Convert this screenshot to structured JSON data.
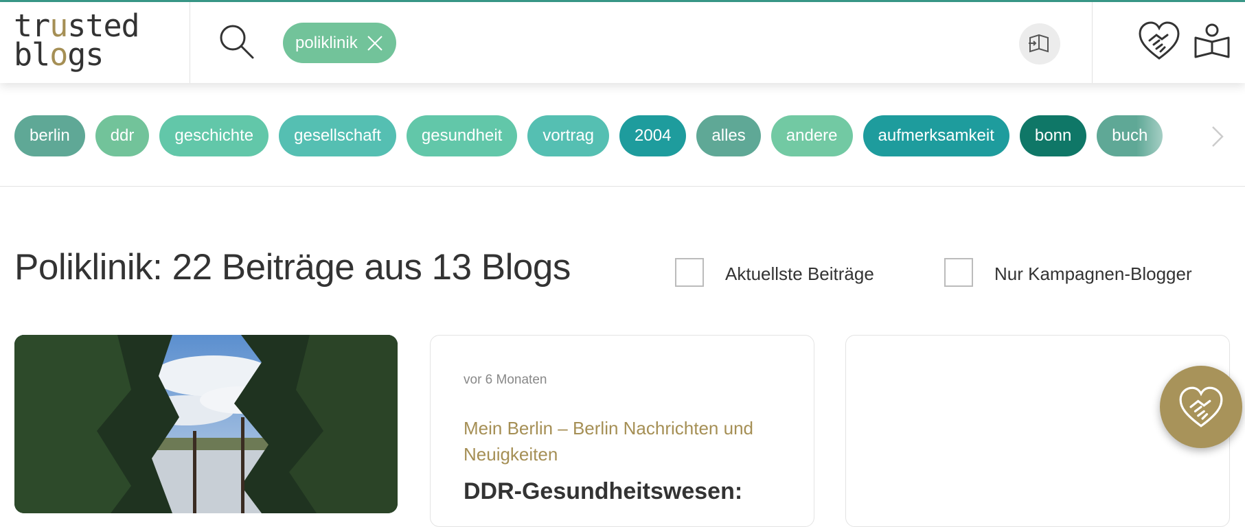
{
  "logo": {
    "line1a": "tr",
    "line1b": "u",
    "line1c": "sted",
    "line2a": "bl",
    "line2b": "o",
    "line2c": "gs"
  },
  "search": {
    "active_tag": "poliklinik"
  },
  "tags": [
    {
      "label": "berlin",
      "color": "#5fa896"
    },
    {
      "label": "ddr",
      "color": "#72c39a"
    },
    {
      "label": "geschichte",
      "color": "#62c7a9"
    },
    {
      "label": "gesellschaft",
      "color": "#55bfb2"
    },
    {
      "label": "gesundheit",
      "color": "#62c7a9"
    },
    {
      "label": "vortrag",
      "color": "#55bfb2"
    },
    {
      "label": "2004",
      "color": "#1e9c9d"
    },
    {
      "label": "alles",
      "color": "#5fa896"
    },
    {
      "label": "andere",
      "color": "#72c9a3"
    },
    {
      "label": "aufmerksamkeit",
      "color": "#1e9c9d"
    },
    {
      "label": "bonn",
      "color": "#0f7767"
    },
    {
      "label": "buch",
      "color": "#5fa896"
    }
  ],
  "heading": "Poliklinik: 22 Beiträge aus 13 Blogs",
  "filters": {
    "latest": "Aktuellste Beiträge",
    "campaign": "Nur Kampagnen-Blogger"
  },
  "cards": [
    {
      "time": "vor 6 Monaten",
      "blog": "Mein Berlin – Berlin Nachrichten und Neuigkeiten",
      "title": "DDR-Gesundheitswesen:"
    }
  ],
  "colors": {
    "accent": "#a58f55",
    "tag_active": "#72c39a",
    "top_line": "#3a9a8a"
  }
}
